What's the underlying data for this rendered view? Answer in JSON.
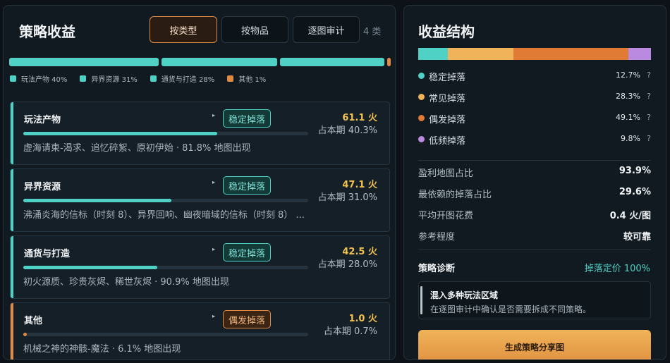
{
  "left_panel": {
    "title": "策略收益",
    "tabs": [
      "按类型",
      "按物品",
      "逐图审计"
    ],
    "active_tab": 0,
    "count_label": "4 类",
    "distribution": [
      {
        "label": "玩法产物 40%",
        "percent": 40,
        "color": "#4fd1c5"
      },
      {
        "label": "异界资源 31%",
        "percent": 31,
        "color": "#4fd1c5"
      },
      {
        "label": "通货与打造 28%",
        "percent": 28,
        "color": "#4fd1c5"
      },
      {
        "label": "其他 1%",
        "percent": 1,
        "color": "#e08a44"
      }
    ],
    "cards": [
      {
        "name": "玩法产物",
        "badge": "稳定掉落",
        "badge_type": "stable",
        "value": "61.1 火",
        "share": "占本期 40.3%",
        "bar_fraction": 0.68,
        "desc": "虚海请柬-渴求、追忆碎絮、原初伊始 · 81.8% 地图出现",
        "accent": "#4fd1c5"
      },
      {
        "name": "异界资源",
        "badge": "稳定掉落",
        "badge_type": "stable",
        "value": "47.1 火",
        "share": "占本期 31.0%",
        "bar_fraction": 0.52,
        "desc": "沸涌炎海的信标（时刻 8）、异界回响、幽夜暗域的信标（时刻 8） ...",
        "accent": "#4fd1c5"
      },
      {
        "name": "通货与打造",
        "badge": "稳定掉落",
        "badge_type": "stable",
        "value": "42.5 火",
        "share": "占本期 28.0%",
        "bar_fraction": 0.47,
        "desc": "初火源质、珍贵灰烬、稀世灰烬 · 90.9% 地图出现",
        "accent": "#4fd1c5"
      },
      {
        "name": "其他",
        "badge": "偶发掉落",
        "badge_type": "rare",
        "value": "1.0 火",
        "share": "占本期 0.7%",
        "bar_fraction": 0.012,
        "desc": "机械之神的神骸-魔法 · 6.1% 地图出现",
        "accent": "#e08a44"
      }
    ]
  },
  "right_panel": {
    "title": "收益结构",
    "structure": [
      {
        "label": "稳定掉落",
        "pct": "12.7%",
        "value": 12.7,
        "color": "#4fd1c5"
      },
      {
        "label": "常见掉落",
        "pct": "28.3%",
        "value": 28.3,
        "color": "#f0b35a"
      },
      {
        "label": "偶发掉落",
        "pct": "49.1%",
        "value": 49.1,
        "color": "#e07b36"
      },
      {
        "label": "低频掉落",
        "pct": "9.8%",
        "value": 9.8,
        "color": "#b98ae0"
      }
    ],
    "help_mark": "?",
    "metrics": [
      {
        "label": "盈利地图占比",
        "value": "93.9%"
      },
      {
        "label": "最依赖的掉落占比",
        "value": "29.6%"
      },
      {
        "label": "平均开图花费",
        "value": "0.4 火/图"
      },
      {
        "label": "参考程度",
        "value": "较可靠"
      }
    ],
    "diagnosis": {
      "title": "策略诊断",
      "value": "掉落定价 100%"
    },
    "note": {
      "title": "混入多种玩法区域",
      "desc": "在逐图审计中确认是否需要拆成不同策略。"
    },
    "share_button": "生成策略分享图"
  }
}
